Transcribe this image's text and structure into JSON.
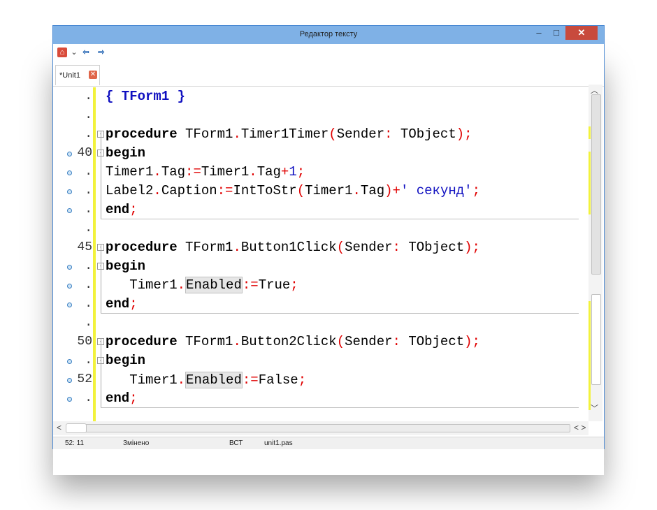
{
  "window": {
    "title": "Редактор тексту",
    "min_glyph": "–",
    "max_glyph": "□",
    "close_glyph": "✕"
  },
  "toolbar": {
    "home_icon": "⌂",
    "dropdown_icon": "⌄",
    "back_icon": "⇦",
    "forward_icon": "⇨"
  },
  "tab": {
    "label": "*Unit1",
    "close_glyph": "✕"
  },
  "editor": {
    "lines": [
      {
        "num": ".",
        "dot": false
      },
      {
        "num": ".",
        "dot": false
      },
      {
        "num": ".",
        "dot": false
      },
      {
        "num": "40",
        "dot": true
      },
      {
        "num": ".",
        "dot": true
      },
      {
        "num": ".",
        "dot": true
      },
      {
        "num": ".",
        "dot": true
      },
      {
        "num": ".",
        "dot": false
      },
      {
        "num": "45",
        "dot": false
      },
      {
        "num": ".",
        "dot": true
      },
      {
        "num": ".",
        "dot": true
      },
      {
        "num": ".",
        "dot": true
      },
      {
        "num": ".",
        "dot": false
      },
      {
        "num": "50",
        "dot": false
      },
      {
        "num": ".",
        "dot": true
      },
      {
        "num": "52",
        "dot": true
      },
      {
        "num": ".",
        "dot": true
      },
      {
        "num": ".",
        "dot": false
      }
    ],
    "code": {
      "l1": "{ TForm1 }",
      "proc1": "procedure",
      "proc1_rest": " TForm1",
      "proc1_name": "Timer1Timer",
      "sender": "Sender",
      "tobject": " TObject",
      "begin": "begin",
      "end": "end",
      "timer1": "Timer1",
      "tag": "Tag",
      "one": "1",
      "label2": "Label2",
      "caption": "Caption",
      "inttostr": "IntToStr",
      "str_sec": "' секунд'",
      "proc2_name": "Button1Click",
      "proc3_name": "Button2Click",
      "enabled": "Enabled",
      "true_val": "True",
      "false_val": "False"
    }
  },
  "hscroll": {
    "left_arrow": "<",
    "right_arrows": "< >"
  },
  "vscroll": {
    "up": "︿",
    "down": "﹀"
  },
  "status": {
    "position": "52: 11",
    "modified": "Змінено",
    "mode": "ВСТ",
    "file": "unit1.pas"
  }
}
